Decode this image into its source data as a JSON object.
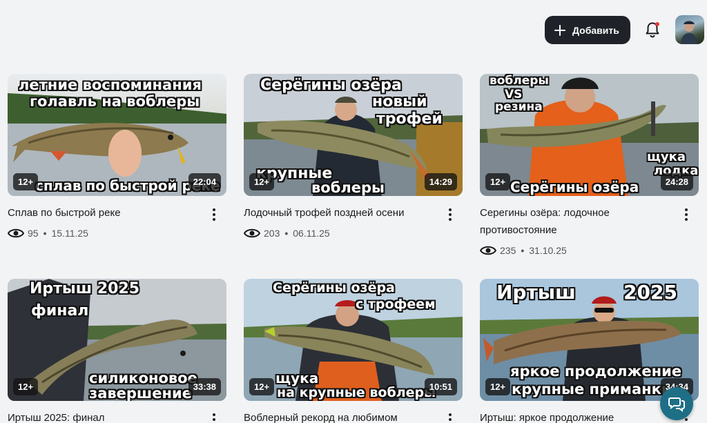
{
  "header": {
    "add_button_label": "Добавить",
    "bell_icon": "bell-icon",
    "notification_dot_color": "#e53935",
    "avatar": "user-avatar"
  },
  "videos": [
    {
      "title": "Сплав по быстрой реке",
      "views": "95",
      "date": "15.11.25",
      "age": "12+",
      "duration": "22:04",
      "captions": [
        "летние воспоминания",
        "голавль на воблеры",
        "сплав по быстрой реке"
      ]
    },
    {
      "title": "Лодочный трофей поздней осени",
      "views": "203",
      "date": "06.11.25",
      "age": "12+",
      "duration": "14:29",
      "captions": [
        "Серёгины озёра",
        "новый",
        "трофей",
        "крупные",
        "воблеры"
      ]
    },
    {
      "title": "Серегины озёра: лодочное противостояние",
      "views": "235",
      "date": "31.10.25",
      "age": "12+",
      "duration": "24:28",
      "captions": [
        "воблеры",
        "VS",
        "резина",
        "щука",
        "лодка",
        "Серёгины озёра"
      ]
    },
    {
      "title": "Иртыш 2025: финал",
      "views": "",
      "date": "",
      "age": "12+",
      "duration": "33:38",
      "captions": [
        "Иртыш 2025",
        "финал",
        "силиконовое",
        "завершение"
      ]
    },
    {
      "title": "Воблерный рекорд на любимом",
      "views": "",
      "date": "",
      "age": "12+",
      "duration": "10:51",
      "captions": [
        "Серёгины озёра",
        "с трофеем",
        "щука",
        "на крупные воблеры"
      ]
    },
    {
      "title": "Иртыш: яркое продолжение",
      "views": "",
      "date": "",
      "age": "12+",
      "duration": "34:34",
      "captions": [
        "Иртыш",
        "2025",
        "яркое продолжение",
        "крупные приманки"
      ]
    }
  ],
  "icons": {
    "eye": "eye-icon",
    "more": "more-vertical-icon",
    "chat": "chat-support-icon"
  },
  "colors": {
    "background": "#f2f3f5",
    "add_button": "#1f2329",
    "chat_button": "#1e6f86"
  }
}
